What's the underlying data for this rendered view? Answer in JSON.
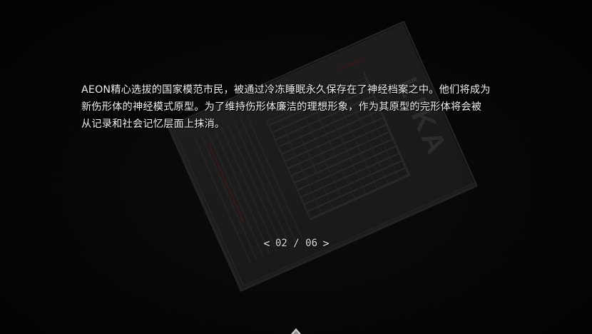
{
  "story": {
    "lines": [
      "AEON精心选拔的国家模范市民，被通过冷冻睡眠永久保存在了神经档案之中。他们将成为",
      "新伤形体的神经模式原型。为了维持伤形体廉洁的理想形象，作为其原型的完形体将会被",
      "从记录和社会记忆层面上抹消。"
    ]
  },
  "pager": {
    "prev_symbol": "<",
    "text": "02 / 06",
    "next_symbol": ">",
    "current": 2,
    "total": 6
  },
  "background": {
    "newspaper_masthead": "LIKA"
  },
  "icons": {
    "prev": "chevron-left-icon",
    "next": "chevron-right-icon",
    "bottom": "chevron-up-icon"
  },
  "colors": {
    "background": "#050505",
    "text": "#f0f0f0"
  }
}
